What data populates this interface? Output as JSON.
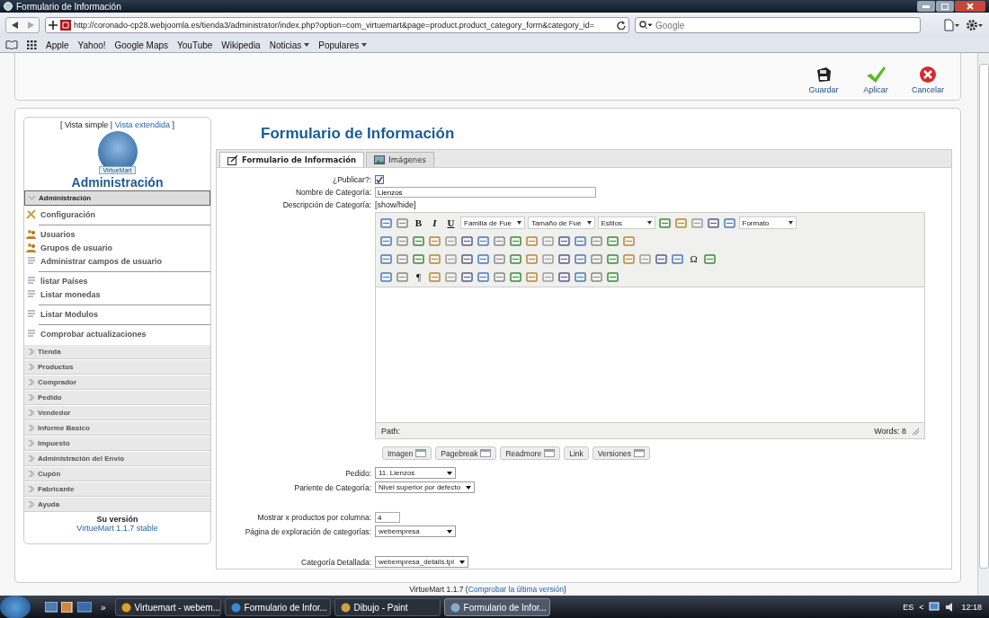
{
  "window": {
    "title": "Formulario de Información"
  },
  "browser": {
    "url": "http://coronado-cp28.webjoomla.es/tienda3/administrator/index.php?option=com_virtuemart&page=product.product_category_form&category_id=",
    "search_placeholder": "Google",
    "bookmarks": [
      {
        "label": "Apple",
        "menu": false
      },
      {
        "label": "Yahoo!",
        "menu": false
      },
      {
        "label": "Google Maps",
        "menu": false
      },
      {
        "label": "YouTube",
        "menu": false
      },
      {
        "label": "Wikipedia",
        "menu": false
      },
      {
        "label": "Noticias",
        "menu": true
      },
      {
        "label": "Populares",
        "menu": true
      }
    ]
  },
  "toolbar": [
    {
      "label": "Guardar",
      "kind": "save"
    },
    {
      "label": "Aplicar",
      "kind": "apply"
    },
    {
      "label": "Cancelar",
      "kind": "cancel"
    }
  ],
  "sidebar": {
    "view_open": "[",
    "view_plain": "Vista simple",
    "view_sep": "|",
    "view_link": "Vista extendida",
    "view_close": "]",
    "logo_text": "VirtueMart",
    "title": "Administración",
    "sections": [
      {
        "label": "Administración",
        "expanded": true,
        "groups": [
          [
            {
              "label": "Configuración",
              "kind": "tools"
            }
          ],
          [
            {
              "label": "Usuarios",
              "kind": "users"
            },
            {
              "label": "Grupos de usuario",
              "kind": "users"
            },
            {
              "label": "Administrar campos de usuario",
              "kind": "list"
            }
          ],
          [
            {
              "label": "listar Países",
              "kind": "list"
            },
            {
              "label": "Listar monedas",
              "kind": "list"
            }
          ],
          [
            {
              "label": "Listar Modulos",
              "kind": "list"
            }
          ],
          [
            {
              "label": "Comprobar actualizaciones",
              "kind": "list"
            }
          ]
        ]
      },
      {
        "label": "Tienda",
        "expanded": false
      },
      {
        "label": "Productos",
        "expanded": false
      },
      {
        "label": "Comprador",
        "expanded": false
      },
      {
        "label": "Pedido",
        "expanded": false
      },
      {
        "label": "Vendedor",
        "expanded": false
      },
      {
        "label": "Informe Basico",
        "expanded": false
      },
      {
        "label": "Impuesto",
        "expanded": false
      },
      {
        "label": "Administración del Envío",
        "expanded": false
      },
      {
        "label": "Cupón",
        "expanded": false
      },
      {
        "label": "Fabricante",
        "expanded": false
      },
      {
        "label": "Ayuda",
        "expanded": false
      }
    ],
    "version_title": "Su versión",
    "version_link": "VirtueMart 1.1.7 stable"
  },
  "content": {
    "title": "Formulario de Información",
    "tabs": [
      {
        "label": "Formulario de Información",
        "selected": true,
        "kind": "form"
      },
      {
        "label": "Imágenes",
        "selected": false,
        "kind": "images"
      }
    ],
    "fields": [
      {
        "label": "¿Publicar?:",
        "kind": "checkbox",
        "checked": true
      },
      {
        "label": "Nombre de Categoría:",
        "kind": "text",
        "value": "Lienzos"
      },
      {
        "label": "Descripción de Categoría:",
        "kind": "editor",
        "toggle": "[show/hide]"
      }
    ],
    "editor": {
      "rows": [
        [
          {
            "kind": "icon"
          },
          {
            "kind": "icon"
          },
          {
            "kind": "bold",
            "text": "B"
          },
          {
            "kind": "italic",
            "text": "I"
          },
          {
            "kind": "underline",
            "text": "U"
          },
          {
            "kind": "select",
            "value": "Familia de Fue"
          },
          {
            "kind": "select",
            "value": "Tamaño de Fue"
          },
          {
            "kind": "select",
            "value": "Estilos"
          },
          {
            "kind": "icon"
          },
          {
            "kind": "icon"
          },
          {
            "kind": "icon"
          },
          {
            "kind": "icon"
          },
          {
            "kind": "icon"
          },
          {
            "kind": "select",
            "value": "Formato"
          }
        ],
        [
          {
            "kind": "icon"
          },
          {
            "kind": "icon"
          },
          {
            "kind": "icon"
          },
          {
            "kind": "icon"
          },
          {
            "kind": "icon"
          },
          {
            "kind": "icon"
          },
          {
            "kind": "icon"
          },
          {
            "kind": "icon"
          },
          {
            "kind": "icon"
          },
          {
            "kind": "icon"
          },
          {
            "kind": "icon"
          },
          {
            "kind": "icon"
          },
          {
            "kind": "icon"
          },
          {
            "kind": "icon"
          },
          {
            "kind": "icon"
          },
          {
            "kind": "icon"
          }
        ],
        [
          {
            "kind": "icon"
          },
          {
            "kind": "icon"
          },
          {
            "kind": "icon"
          },
          {
            "kind": "icon"
          },
          {
            "kind": "icon"
          },
          {
            "kind": "icon"
          },
          {
            "kind": "icon"
          },
          {
            "kind": "icon"
          },
          {
            "kind": "icon"
          },
          {
            "kind": "icon"
          },
          {
            "kind": "icon"
          },
          {
            "kind": "icon"
          },
          {
            "kind": "icon"
          },
          {
            "kind": "icon"
          },
          {
            "kind": "icon"
          },
          {
            "kind": "icon"
          },
          {
            "kind": "icon"
          },
          {
            "kind": "icon"
          },
          {
            "kind": "icon"
          },
          {
            "kind": "glyph",
            "text": "Ω"
          },
          {
            "kind": "icon"
          }
        ],
        [
          {
            "kind": "icon"
          },
          {
            "kind": "icon"
          },
          {
            "kind": "glyph",
            "text": "¶"
          },
          {
            "kind": "icon"
          },
          {
            "kind": "icon"
          },
          {
            "kind": "icon"
          },
          {
            "kind": "icon"
          },
          {
            "kind": "icon"
          },
          {
            "kind": "icon"
          },
          {
            "kind": "icon"
          },
          {
            "kind": "icon"
          },
          {
            "kind": "icon"
          },
          {
            "kind": "icon"
          },
          {
            "kind": "icon"
          },
          {
            "kind": "icon"
          }
        ]
      ],
      "path_label": "Path:",
      "words": "Words: 8",
      "buttons": [
        "Imagen",
        "Pagebreak",
        "Readmore",
        "Link",
        "Versiones"
      ]
    },
    "field_groups": [
      [
        {
          "label": "Pedido:",
          "kind": "select",
          "value": "11. Lienzos"
        },
        {
          "label": "Pariente de Categoría:",
          "kind": "select",
          "value": "Nivel superior por defecto"
        }
      ],
      [
        {
          "label": "Mostrar x productos por columna:",
          "kind": "text",
          "value": "4"
        },
        {
          "label": "Página de exploración de categorías:",
          "kind": "select",
          "value": "webempresa"
        }
      ],
      [
        {
          "label": "Categoría Detallada:",
          "kind": "select",
          "value": "webempresa_details.tpl"
        }
      ]
    ]
  },
  "footer": {
    "text": "VirtueMart 1.1.7 (",
    "link": "Comprobar la última versión",
    "text_end": ")"
  },
  "taskbar": {
    "more": "»",
    "tasks": [
      {
        "label": "Virtuemart - webem...",
        "selected": false
      },
      {
        "label": "Formulario de Infor...",
        "selected": false
      },
      {
        "label": "Dibujo - Paint",
        "selected": false
      },
      {
        "label": "Formulario de Infor...",
        "selected": true
      }
    ],
    "language": "ES",
    "tray_arrow": "<",
    "clock": "12:18"
  }
}
